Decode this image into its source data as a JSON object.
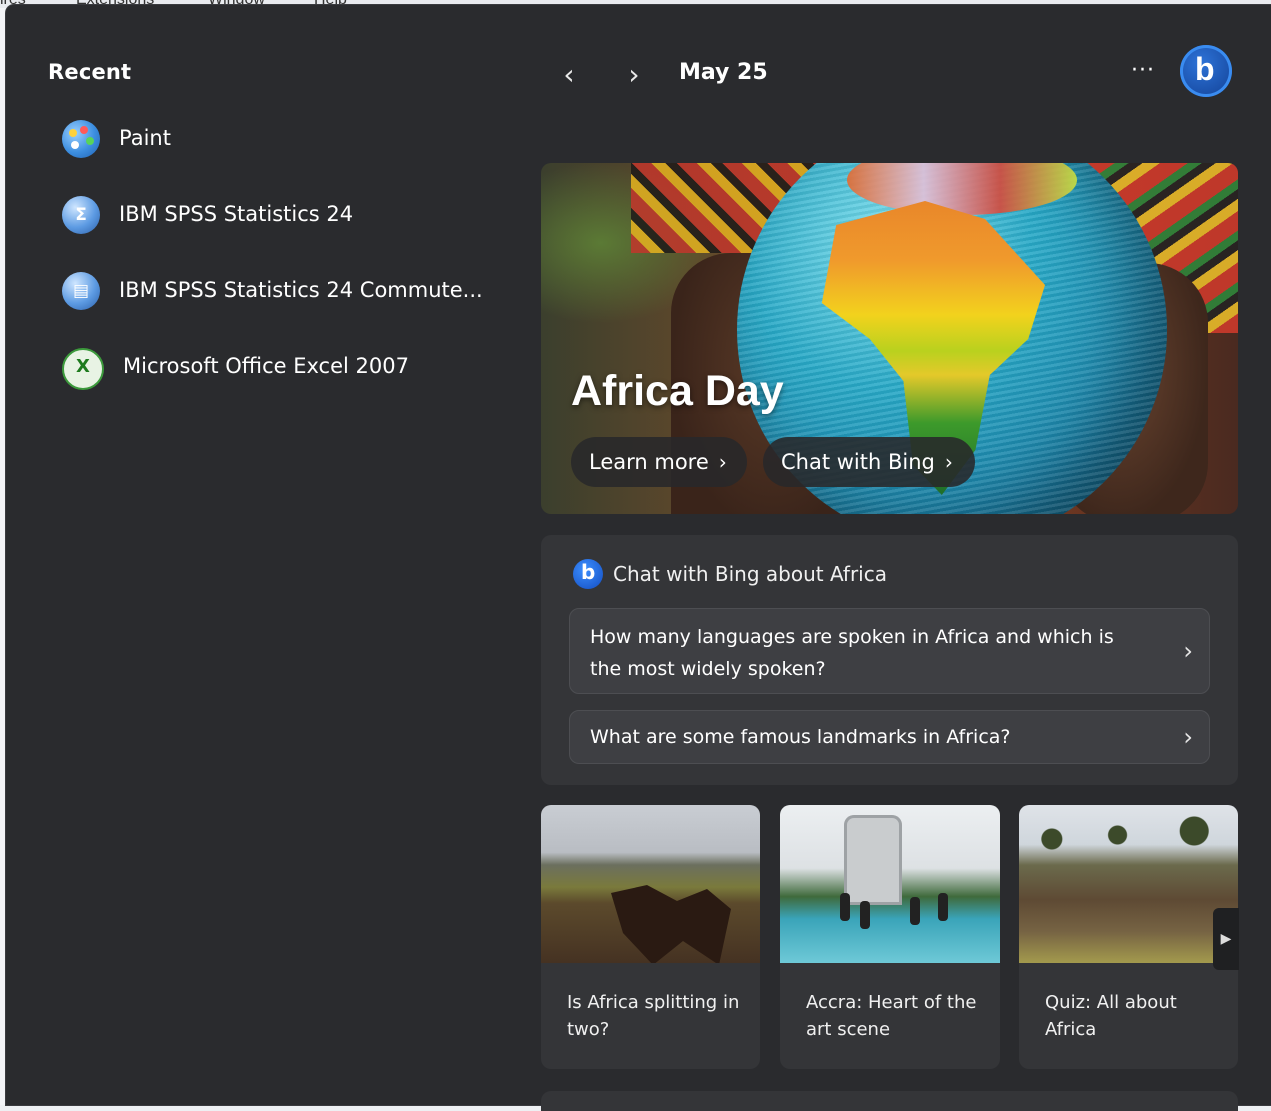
{
  "background_app": {
    "menu": [
      "ires",
      "Extensions",
      "Window",
      "Help"
    ]
  },
  "recent": {
    "title": "Recent",
    "items": [
      {
        "label": "Paint",
        "icon": "paint-icon"
      },
      {
        "label": "IBM SPSS Statistics 24",
        "icon": "spss-icon"
      },
      {
        "label": "IBM SPSS Statistics 24 Commute...",
        "icon": "spss-commuter-icon"
      },
      {
        "label": "Microsoft Office Excel 2007",
        "icon": "excel-icon"
      }
    ]
  },
  "topbar": {
    "prev_glyph": "‹",
    "next_glyph": "›",
    "date": "May 25",
    "more_glyph": "···",
    "bing_glyph": "b"
  },
  "hero": {
    "title": "Africa Day",
    "learn_more": "Learn more",
    "chat_with_bing": "Chat with Bing",
    "chevron": "›"
  },
  "chat": {
    "title": "Chat with Bing about Africa",
    "questions": [
      "How many languages are spoken in Africa and which is the most widely spoken?",
      "What are some famous landmarks in Africa?"
    ],
    "chevron": "›"
  },
  "cards": [
    {
      "caption": "Is Africa splitting in two?"
    },
    {
      "caption": "Accra: Heart of the art scene"
    },
    {
      "caption": "Quiz: All about Africa"
    }
  ],
  "colors": {
    "panel_bg": "#2a2b2e",
    "card_bg": "#343538",
    "bing_blue": "#1a4fa8"
  }
}
